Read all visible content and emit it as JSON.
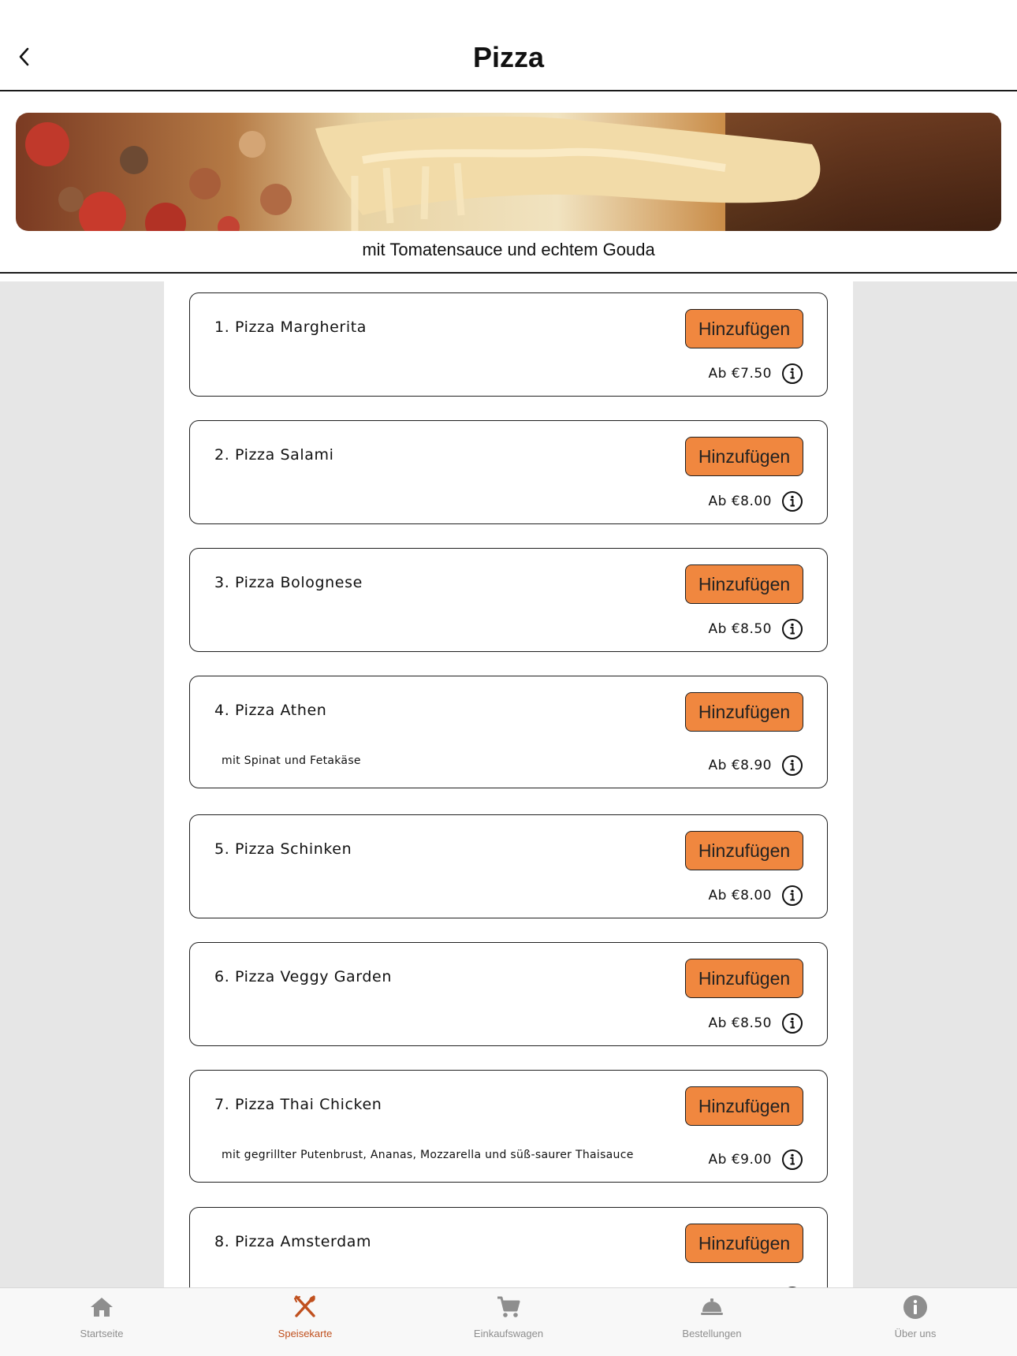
{
  "header": {
    "title": "Pizza"
  },
  "hero": {
    "subtitle": "mit Tomatensauce und echtem Gouda"
  },
  "items": [
    {
      "name": "1. Pizza Margherita",
      "desc": "",
      "price": "Ab €7.50",
      "button": "Hinzufügen"
    },
    {
      "name": "2. Pizza Salami",
      "desc": "",
      "price": "Ab €8.00",
      "button": "Hinzufügen"
    },
    {
      "name": "3. Pizza Bolognese",
      "desc": "",
      "price": "Ab €8.50",
      "button": "Hinzufügen"
    },
    {
      "name": "4. Pizza Athen",
      "desc": "mit Spinat und Fetakäse",
      "price": "Ab €8.90",
      "button": "Hinzufügen"
    },
    {
      "name": "5. Pizza Schinken",
      "desc": "",
      "price": "Ab €8.00",
      "button": "Hinzufügen"
    },
    {
      "name": "6. Pizza Veggy Garden",
      "desc": "",
      "price": "Ab €8.50",
      "button": "Hinzufügen"
    },
    {
      "name": "7. Pizza Thai Chicken",
      "desc": "mit gegrillter Putenbrust, Ananas, Mozzarella und süß-saurer Thaisauce",
      "price": "Ab €9.00",
      "button": "Hinzufügen"
    },
    {
      "name": "8. Pizza Amsterdam",
      "desc": "",
      "price": "",
      "button": "Hinzufügen"
    }
  ],
  "tabs": [
    {
      "label": "Startseite",
      "icon": "home-icon",
      "active": false
    },
    {
      "label": "Speisekarte",
      "icon": "fork-knife-icon",
      "active": true
    },
    {
      "label": "Einkaufswagen",
      "icon": "cart-icon",
      "active": false
    },
    {
      "label": "Bestellungen",
      "icon": "cloche-icon",
      "active": false
    },
    {
      "label": "Über uns",
      "icon": "info-icon",
      "active": false
    }
  ],
  "colors": {
    "accent": "#f0873f",
    "active_tab": "#c0501e",
    "inactive_tab": "#8e8e8e",
    "side_background": "#e6e6e6"
  }
}
